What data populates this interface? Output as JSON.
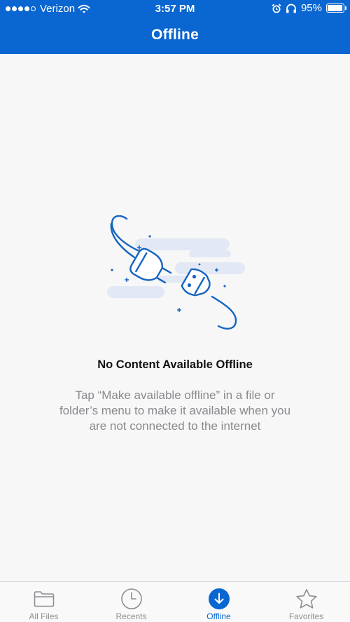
{
  "status_bar": {
    "carrier": "Verizon",
    "time": "3:57 PM",
    "battery_percent": "95%",
    "battery_level": 0.95,
    "icons": [
      "signal-dots-icon",
      "wifi-icon",
      "alarm-icon",
      "headphones-icon",
      "battery-icon"
    ]
  },
  "header": {
    "title": "Offline"
  },
  "empty_state": {
    "icon": "unplugged-plug-icon",
    "title": "No Content Available Offline",
    "description_lines": [
      "Tap “Make available offline” in a file or",
      "folder’s menu to make it available when you",
      "are not connected to the internet"
    ]
  },
  "tabbar": {
    "tabs": [
      {
        "label": "All Files",
        "icon": "folder-icon",
        "active": false
      },
      {
        "label": "Recents",
        "icon": "clock-icon",
        "active": false
      },
      {
        "label": "Offline",
        "icon": "download-icon",
        "active": true
      },
      {
        "label": "Favorites",
        "icon": "star-icon",
        "active": false
      }
    ]
  },
  "colors": {
    "brand_blue": "#0a66d0",
    "background": "#f7f7f8",
    "inactive_gray": "#8e8e93",
    "illustration_blue": "#1565c0",
    "cloud": "#e3e8f5"
  }
}
